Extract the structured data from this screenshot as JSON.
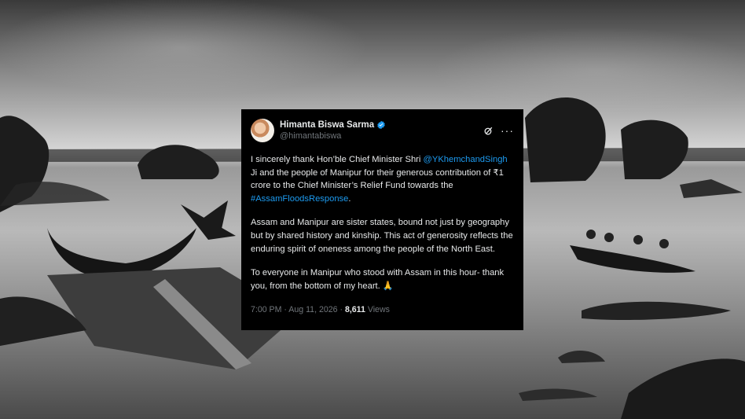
{
  "tweet": {
    "author_name": "Himanta Biswa Sarma",
    "handle": "@himantabiswa",
    "paragraph1": {
      "a": "I sincerely thank Hon’ble Chief Minister Shri ",
      "mention": "@YKhemchandSingh",
      "b": " Ji and the people of Manipur for their generous contribution of ₹1 crore to the Chief Minister’s Relief Fund towards the ",
      "hashtag": "#AssamFloodsResponse",
      "c": "."
    },
    "paragraph2": "Assam and Manipur are sister states, bound not just by geography but by shared history and kinship. This act of generosity reflects the enduring spirit of oneness among the people of the North East.",
    "paragraph3": "To everyone in Manipur who stood with Assam in this hour- thank you, from the bottom of my heart. 🙏",
    "timestamp": "7:00 PM · Aug 11, 2026 · ",
    "views_count": "8,611",
    "views_label": " Views",
    "icons": [
      "avatar",
      "verified-badge-icon",
      "grok-icon",
      "more-options-icon"
    ],
    "colors": {
      "link": "#1d9bf0",
      "card_bg": "#000000",
      "secondary_text": "#71767b"
    }
  }
}
